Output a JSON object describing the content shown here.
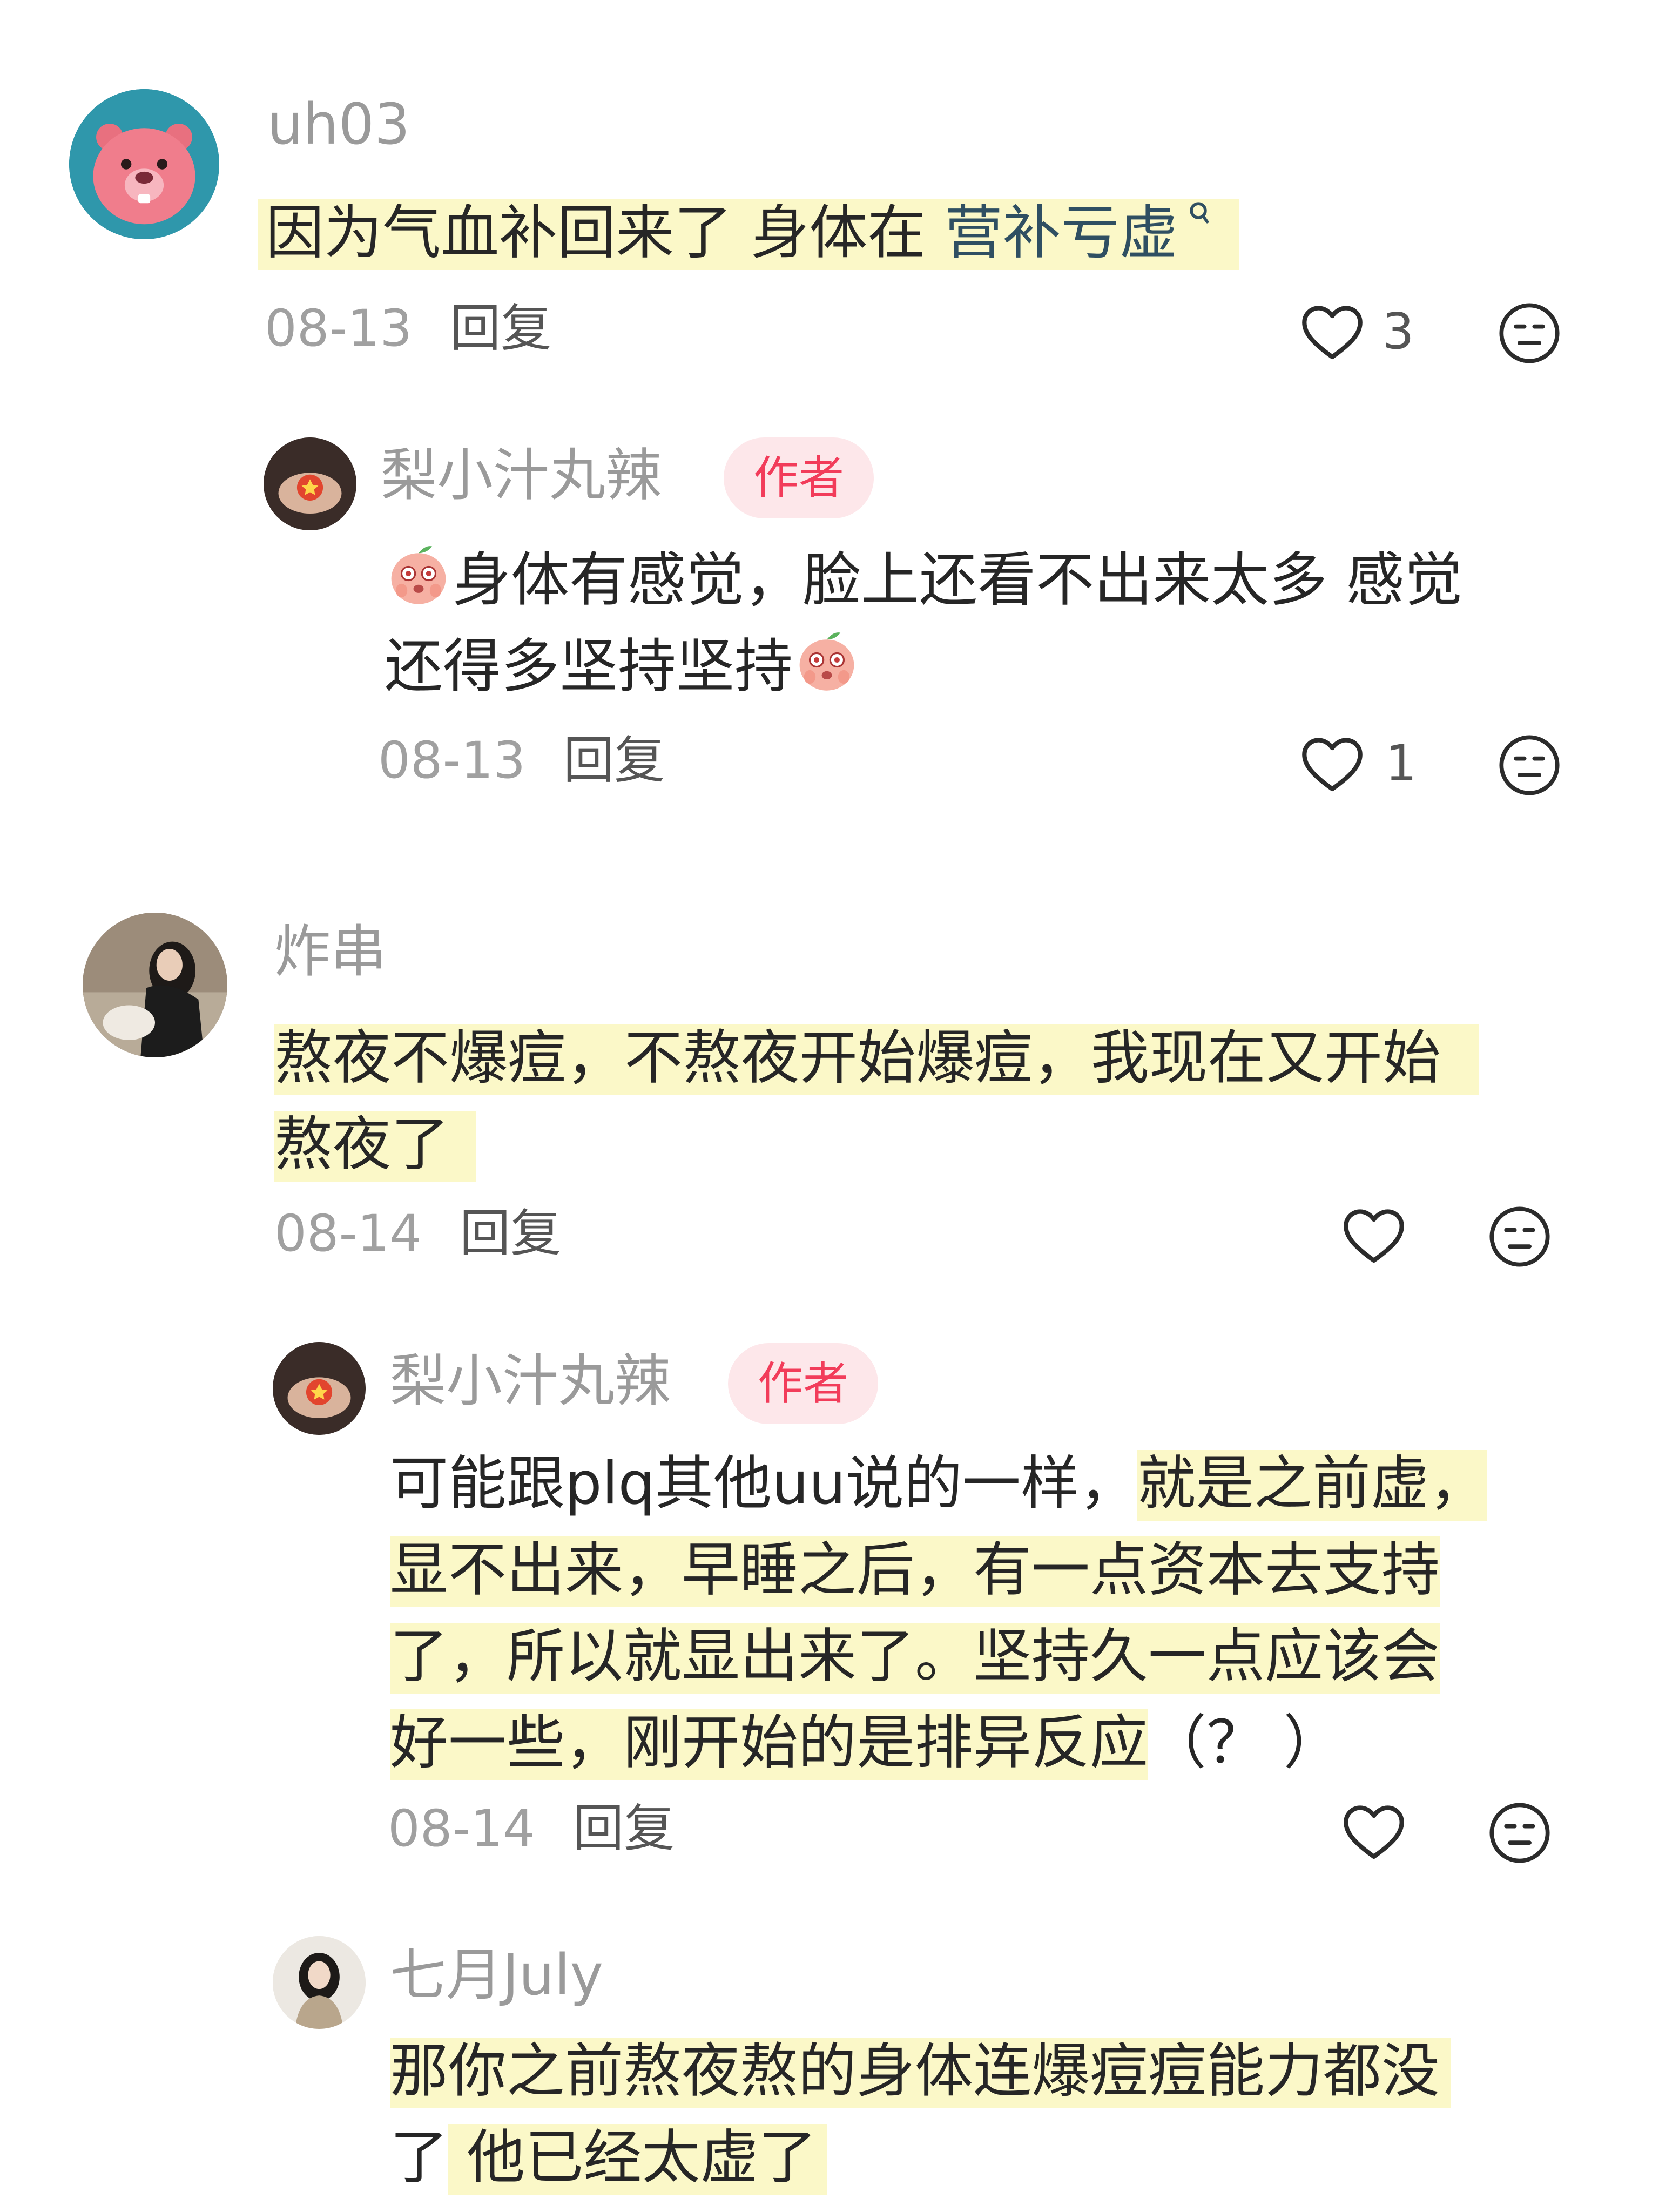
{
  "comments": [
    {
      "username": "uh03",
      "text_a": "因为气血补回来了 身体在 ",
      "text_link": "营补亏虚",
      "date": "08-13",
      "reply": "回复",
      "likes": "3",
      "reply_item": {
        "username": "梨小汁丸辣",
        "badge": "作者",
        "line1": "身体有感觉，脸上还看不出来太多 感觉",
        "line2": "还得多坚持坚持",
        "date": "08-13",
        "reply": "回复",
        "likes": "1"
      }
    },
    {
      "username": "炸串",
      "line1": "熬夜不爆痘，不熬夜开始爆痘，我现在又开始",
      "line2": "熬夜了",
      "date": "08-14",
      "reply": "回复",
      "reply_item": {
        "username": "梨小汁丸辣",
        "badge": "作者",
        "line1a": "可能跟plq其他uu说的一样，",
        "line1b": "就是之前虚，",
        "line2": "显不出来，早睡之后，有一点资本去支持",
        "line3": "了，所以就显出来了。坚持久一点应该会",
        "line4a": "好一些，刚开始的是排异反应",
        "line4b": "（？ ）",
        "date": "08-14",
        "reply": "回复"
      },
      "reply_item2": {
        "username": "七月July",
        "line1": "那你之前熬夜熬的身体连爆痘痘能力都没",
        "line2a": "了",
        "line2b": " 他已经太虚了"
      }
    }
  ],
  "icons": {
    "like": "heart-outline-icon",
    "dislike": "neutral-face-icon",
    "emoji": "peach-cry-emoji",
    "search": "search-small-icon"
  },
  "colors": {
    "highlight": "#fbf8c8",
    "badge_bg": "#fde7ea",
    "badge_text": "#f23c5a",
    "link": "#2f4f62"
  }
}
